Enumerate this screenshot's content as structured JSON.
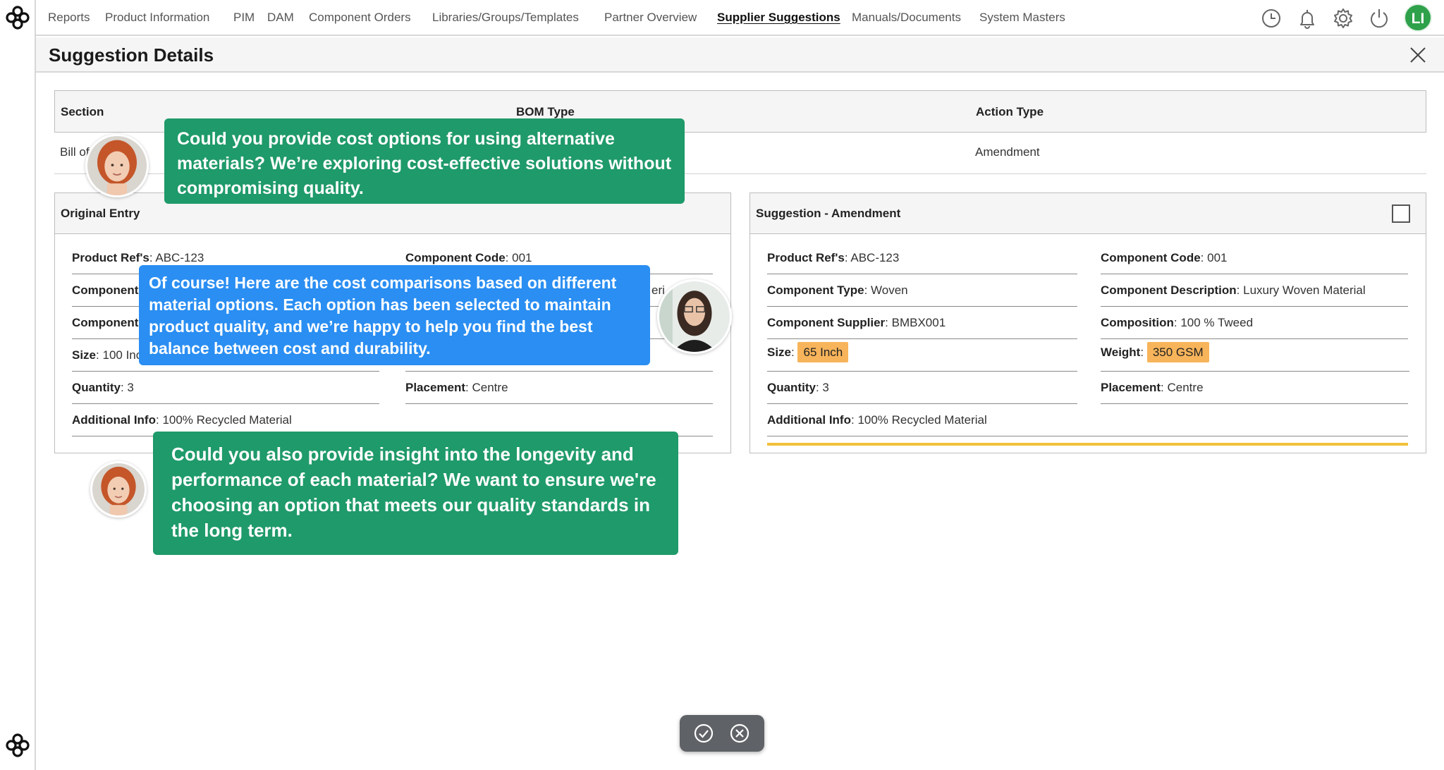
{
  "nav": {
    "items": [
      "Reports",
      "Product Information",
      "PIM",
      "DAM",
      "Component Orders",
      "Libraries/Groups/Templates",
      "Partner Overview",
      "Supplier Suggestions",
      "Manuals/Documents",
      "System Masters"
    ],
    "active": "Supplier Suggestions",
    "icons": [
      "history-icon",
      "bell-icon",
      "gear-icon",
      "power-icon"
    ],
    "user_initials": "LI",
    "user_color": "#2ea14a"
  },
  "panel": {
    "title": "Suggestion Details"
  },
  "summary": {
    "headers": [
      "Section",
      "BOM Type",
      "Action Type"
    ],
    "row": [
      "Bill of",
      "",
      "Amendment"
    ]
  },
  "original": {
    "title": "Original Entry",
    "fields": [
      {
        "label": "Product Ref's",
        "value": "ABC-123"
      },
      {
        "label": "Component Code",
        "value": "001"
      },
      {
        "label": "Component",
        "value": ""
      },
      {
        "label": "",
        "value": "eri"
      },
      {
        "label": "Component",
        "value": ""
      },
      {
        "label": "Size",
        "value": "100 Inc"
      },
      {
        "label": "Quantity",
        "value": "3"
      },
      {
        "label": "Placement",
        "value": "Centre"
      },
      {
        "label": "Additional Info",
        "value": "100% Recycled Material"
      }
    ]
  },
  "suggestion": {
    "title": "Suggestion - Amendment",
    "fields": [
      {
        "label": "Product Ref's",
        "value": "ABC-123"
      },
      {
        "label": "Component Code",
        "value": "001"
      },
      {
        "label": "Component Type",
        "value": "Woven"
      },
      {
        "label": "Component Description",
        "value": "Luxury Woven Material"
      },
      {
        "label": "Component Supplier",
        "value": "BMBX001"
      },
      {
        "label": "Composition",
        "value": "100 % Tweed"
      },
      {
        "label": "Size",
        "value": "65 Inch"
      },
      {
        "label": "Weight",
        "value": "350 GSM"
      },
      {
        "label": "Quantity",
        "value": "3"
      },
      {
        "label": "Placement",
        "value": "Centre"
      },
      {
        "label": "Additional Info",
        "value": "100% Recycled Material"
      }
    ],
    "highlight_color": "#f7b45a"
  },
  "chat": [
    {
      "text": "Could you provide cost options for using alternative materials? We’re exploring cost-effective solutions without compromising quality.",
      "color": "#1f9a6a"
    },
    {
      "text": "Of course! Here are the cost comparisons based on different material options. Each option has been selected to maintain product quality, and we’re happy to help you find the best balance between cost and durability.",
      "color": "#2a8ef2"
    },
    {
      "text": "Could you also provide insight into the longevity and performance of each material? We want to ensure we're choosing an option that meets our quality standards in the long term.",
      "color": "#1f9a6a"
    }
  ],
  "actions": [
    "check-circle-icon",
    "x-circle-icon"
  ]
}
